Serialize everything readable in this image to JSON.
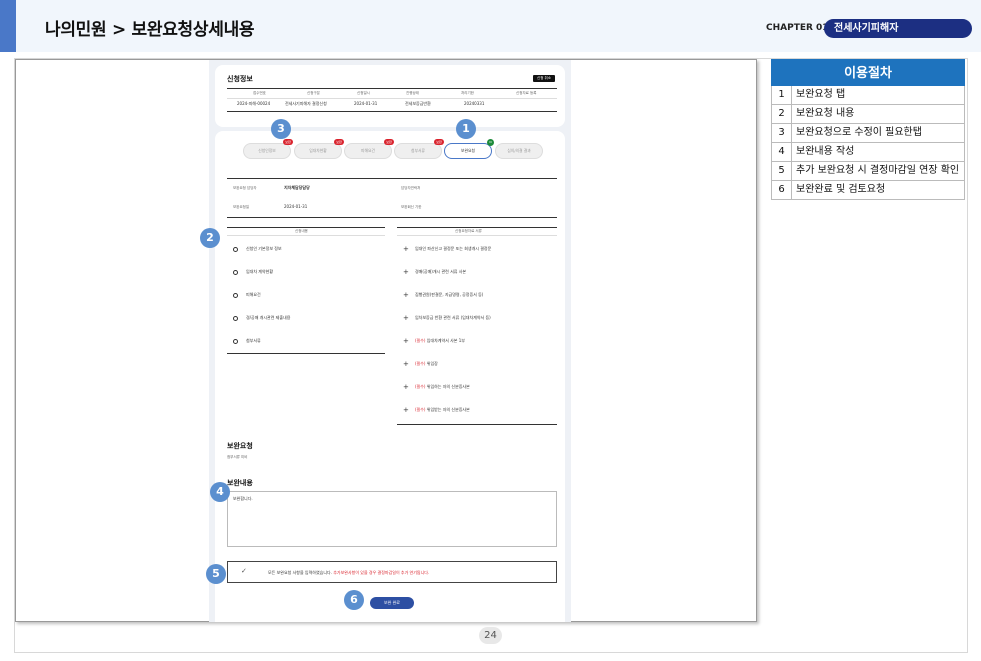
{
  "header": {
    "title": "나의민원 > 보완요청상세내용",
    "chapter_label": "CHAPTER 01",
    "chapter_name": "전세사기피해자"
  },
  "app": {
    "application_info": {
      "title": "신청정보",
      "cancel_button": "신청 취소",
      "columns": [
        "접수번호",
        "신청구분",
        "신청일시",
        "진행상태",
        "처리기한",
        "신청자료 등록"
      ],
      "row": [
        "2024-피해-00024",
        "전세사기피해자 결정신청",
        "2024-01-31",
        "전세보증금반환",
        "20240331",
        ""
      ]
    },
    "tabs": [
      {
        "label": "신청인정보",
        "badge": "보완"
      },
      {
        "label": "임대차현황",
        "badge": "보완"
      },
      {
        "label": "피해요건",
        "badge": "보완"
      },
      {
        "label": "첨부서류",
        "badge": "보완"
      },
      {
        "label": "보완요청",
        "badge": "N"
      },
      {
        "label": "심의/의결 결과",
        "badge": ""
      }
    ],
    "request_meta": {
      "left_label_1": "보완요청 담당자",
      "left_value_1": "지자체담당담당",
      "right_label_1": "담당자연락처",
      "left_label_2": "보완요청일",
      "left_value_2": "2024-01-31",
      "right_label_2": "보완회신 기한"
    },
    "request_items": {
      "header": "신청내용",
      "items": [
        "신청인 기본정보 정보",
        "임대차 계약현황",
        "피해요건",
        "경/공매 개시관련 제출내용",
        "첨부서류"
      ]
    },
    "document_items": {
      "header": "신청요청자료 서류",
      "items": [
        {
          "prefix": "",
          "text": "임대인 파산신고 결정문 또는 회생개시 결정문"
        },
        {
          "prefix": "",
          "text": "경매(공매)개시 관련 서류 사본"
        },
        {
          "prefix": "",
          "text": "집행권원(판결문, 지급명령, 공정증서 등)"
        },
        {
          "prefix": "",
          "text": "임차보증금 반환 관련 서류 (임대차계약서 등)"
        },
        {
          "prefix": "(필수)",
          "text": "임대차계약서 사본 1부"
        },
        {
          "prefix": "(필수)",
          "text": "위임장"
        },
        {
          "prefix": "(필수)",
          "text": "위임하는 자의 신분증사본"
        },
        {
          "prefix": "(필수)",
          "text": "위임받는 자의 신분증사본"
        }
      ]
    },
    "supplement_request": {
      "title": "보완요청",
      "body": "첨부서류 미비"
    },
    "supplement_content": {
      "title": "보완내용",
      "value": "보완합니다."
    },
    "confirm": {
      "text": "모든 보완요청 사항을 입력하였습니다.",
      "warning": "추가보완사항이 있을 경우 결정마감일이 추가 연기됩니다."
    },
    "submit_label": "보완 완료"
  },
  "markers": [
    "1",
    "2",
    "3",
    "4",
    "5",
    "6"
  ],
  "procedure": {
    "title": "이용절차",
    "steps": [
      {
        "num": "1",
        "text": "보완요청 탭"
      },
      {
        "num": "2",
        "text": "보완요청 내용"
      },
      {
        "num": "3",
        "text": "보완요청으로 수정이 필요한탭"
      },
      {
        "num": "4",
        "text": "보완내용 작성"
      },
      {
        "num": "5",
        "text": "추가 보완요청 시 결정마감일 연장 확인"
      },
      {
        "num": "6",
        "text": "보완완료 및 검토요청"
      }
    ]
  },
  "page_number": "24"
}
